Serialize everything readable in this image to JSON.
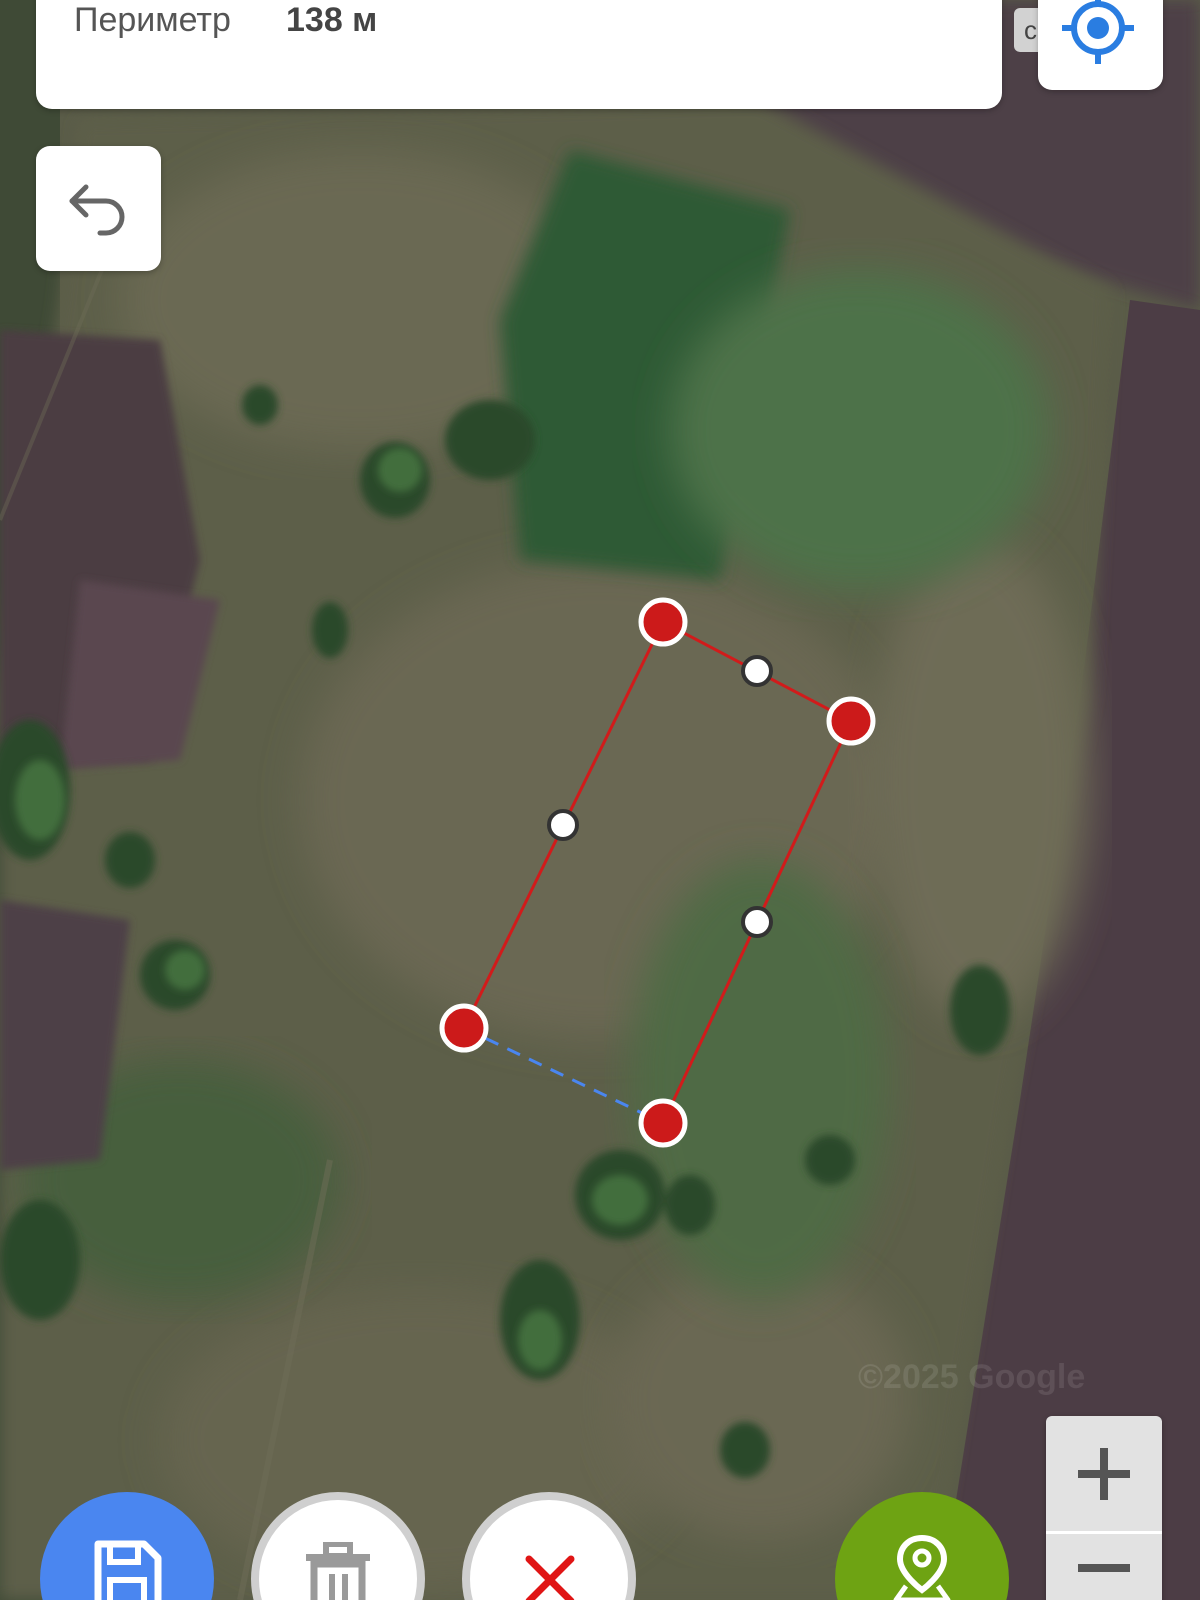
{
  "measure_panel": {
    "label": "Периметр",
    "value": "138 м"
  },
  "hidden_tab": {
    "text": "c"
  },
  "attribution": {
    "text": "©2025 Google"
  },
  "zoom": {
    "in_label": "+",
    "out_label": "−"
  },
  "icons": {
    "locate": "crosshair-locate-icon",
    "undo": "undo-arrow-icon",
    "save": "floppy-disk-icon",
    "delete": "trash-icon",
    "cancel": "close-x-icon",
    "add_point": "map-pin-icon"
  },
  "colors": {
    "polygon_edge": "#d11b1b",
    "vertex_fill": "#cc1a1a",
    "closing_edge": "#4a86f0",
    "save_button": "#4a86f0",
    "add_point_button": "#6ea313",
    "cancel_icon": "#e01515",
    "locate_icon": "#2a7de1"
  }
}
